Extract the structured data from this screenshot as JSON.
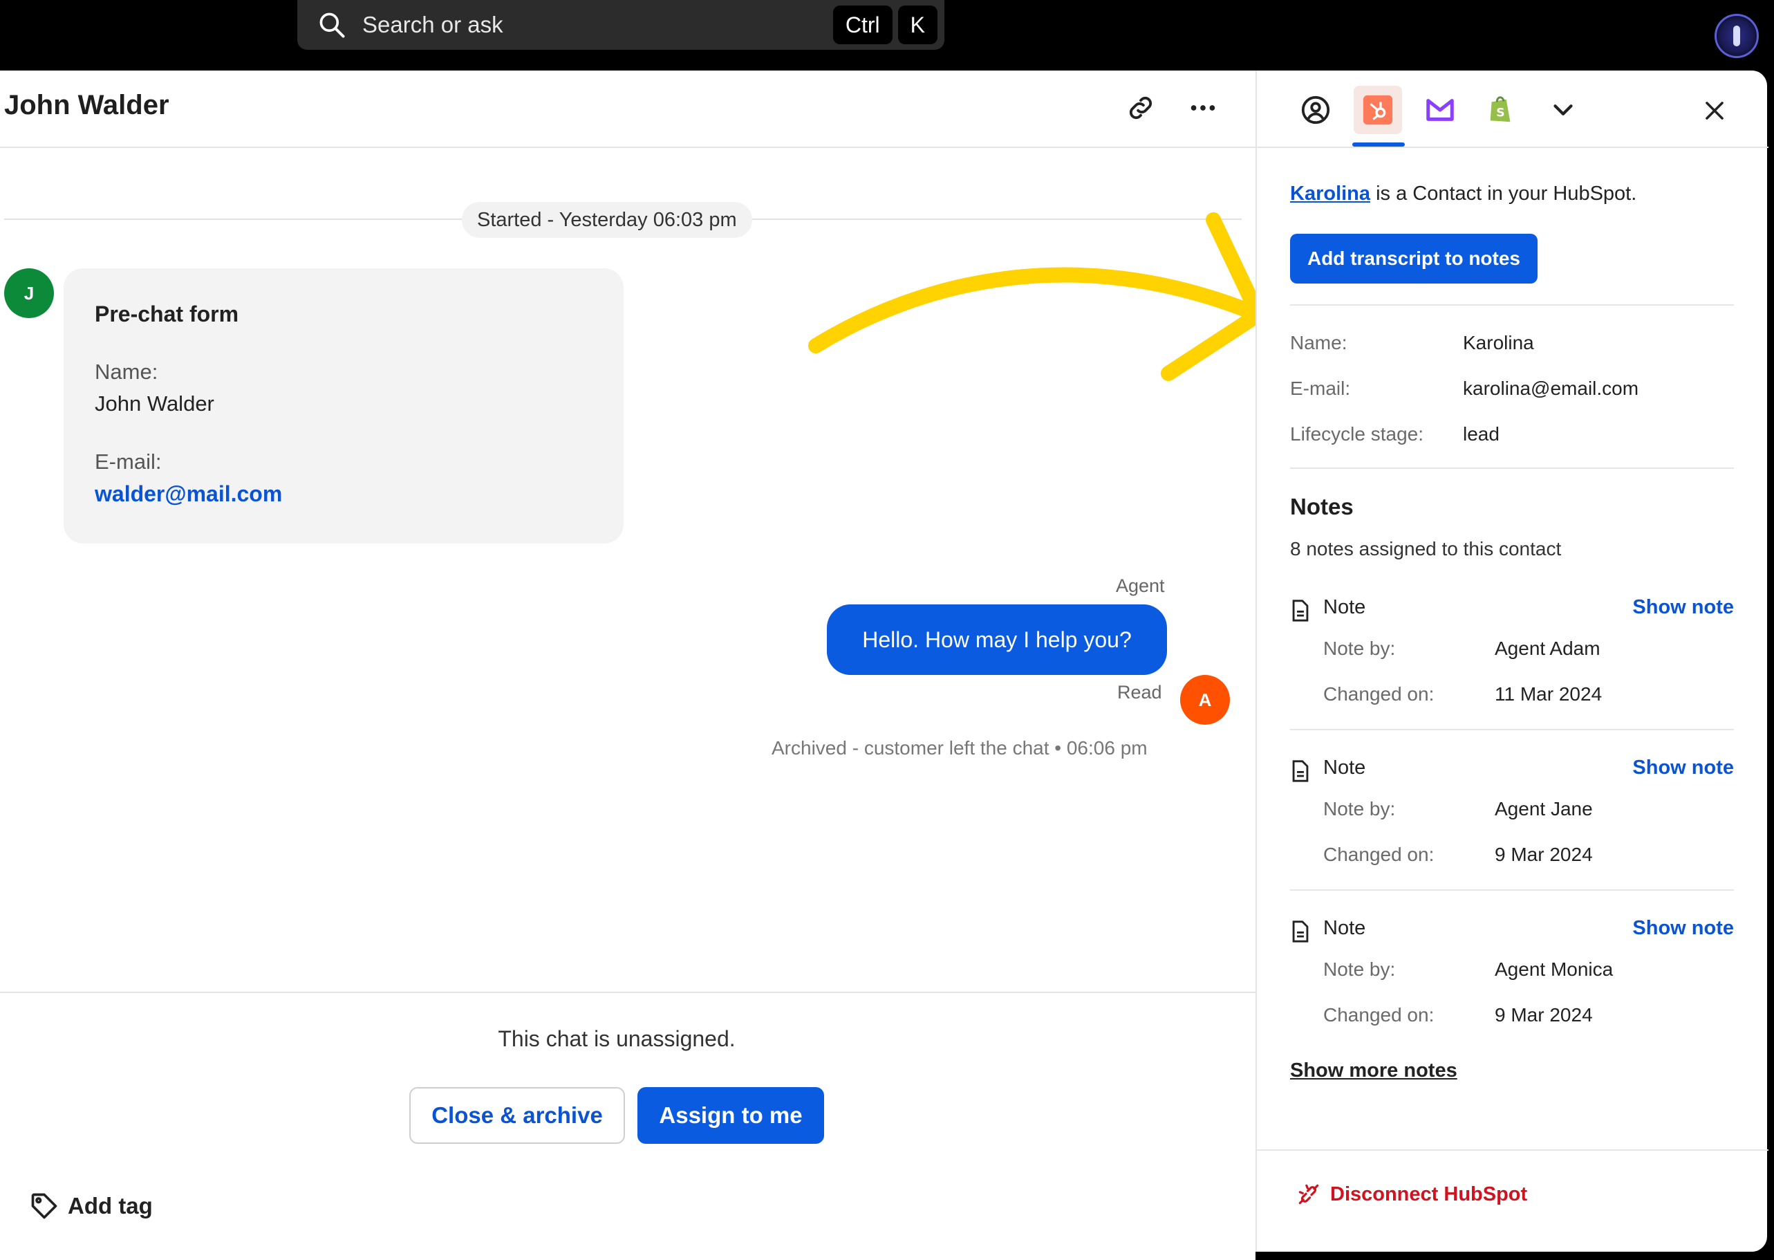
{
  "topbar": {
    "search_placeholder": "Search or ask",
    "shortcut_keys": [
      "Ctrl",
      "K"
    ]
  },
  "chat": {
    "title": "John Walder",
    "started": "Started - Yesterday 06:03 pm",
    "customer_avatar_initial": "J",
    "prechat_form": {
      "title": "Pre-chat form",
      "name_label": "Name:",
      "name_value": "John Walder",
      "email_label": "E-mail:",
      "email_value": "walder@mail.com"
    },
    "agent_label": "Agent",
    "agent_avatar_initial": "A",
    "agent_message": "Hello. How may I help you?",
    "read_status": "Read",
    "archived_status": "Archived - customer left the chat • 06:06 pm",
    "unassigned_text": "This chat is unassigned.",
    "close_archive_label": "Close & archive",
    "assign_label": "Assign to me",
    "add_tag_label": "Add tag"
  },
  "sidepanel": {
    "contact_name": "Karolina",
    "contact_suffix": " is a Contact in your HubSpot.",
    "transcript_button": "Add transcript to notes",
    "fields": [
      {
        "label": "Name:",
        "value": "Karolina"
      },
      {
        "label": "E-mail:",
        "value": "karolina@email.com"
      },
      {
        "label": "Lifecycle stage:",
        "value": "lead"
      }
    ],
    "notes_title": "Notes",
    "notes_count": "8 notes assigned to this contact",
    "notes": [
      {
        "title": "Note",
        "show": "Show note",
        "by_label": "Note by:",
        "by": "Agent Adam",
        "changed_label": "Changed on:",
        "changed": "11 Mar 2024"
      },
      {
        "title": "Note",
        "show": "Show note",
        "by_label": "Note by:",
        "by": "Agent Jane",
        "changed_label": "Changed on:",
        "changed": "9 Mar 2024"
      },
      {
        "title": "Note",
        "show": "Show note",
        "by_label": "Note by:",
        "by": "Agent Monica",
        "changed_label": "Changed on:",
        "changed": "9 Mar 2024"
      }
    ],
    "show_more": "Show more notes",
    "disconnect": "Disconnect HubSpot"
  },
  "colors": {
    "accent": "#0a5be0",
    "hubspot": "#ff7a59",
    "danger": "#d0131f",
    "annotation_arrow": "#ffd200"
  }
}
